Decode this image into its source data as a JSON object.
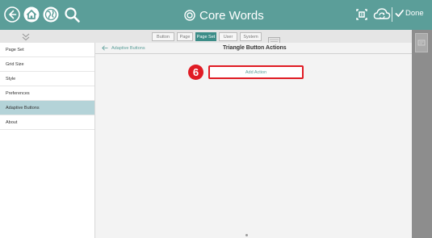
{
  "app": {
    "title": "Core Words",
    "done_label": "Done"
  },
  "toolbar": {
    "icons": [
      "back-icon",
      "home-icon",
      "world-icon",
      "search-icon",
      "edit-frame-icon",
      "sync-icon",
      "checkmark-icon"
    ]
  },
  "tabs": [
    {
      "label": "Button",
      "active": false
    },
    {
      "label": "Page",
      "active": false
    },
    {
      "label": "Page Set",
      "active": true
    },
    {
      "label": "User",
      "active": false
    },
    {
      "label": "System",
      "active": false
    }
  ],
  "sidebar": {
    "items": [
      {
        "label": "Page Set",
        "active": false
      },
      {
        "label": "Grid Size",
        "active": false
      },
      {
        "label": "Style",
        "active": false
      },
      {
        "label": "Preferences",
        "active": false
      },
      {
        "label": "Adaptive Buttons",
        "active": true
      },
      {
        "label": "About",
        "active": false
      }
    ]
  },
  "main": {
    "back_label": "Adaptive Buttons",
    "title": "Triangle Button Actions",
    "add_action_label": "Add Action",
    "step_number": "6"
  },
  "colors": {
    "accent": "#5b9e99",
    "active_tab": "#3d8d88",
    "sidebar_active": "#b4d3d8",
    "highlight": "#e01b24"
  }
}
